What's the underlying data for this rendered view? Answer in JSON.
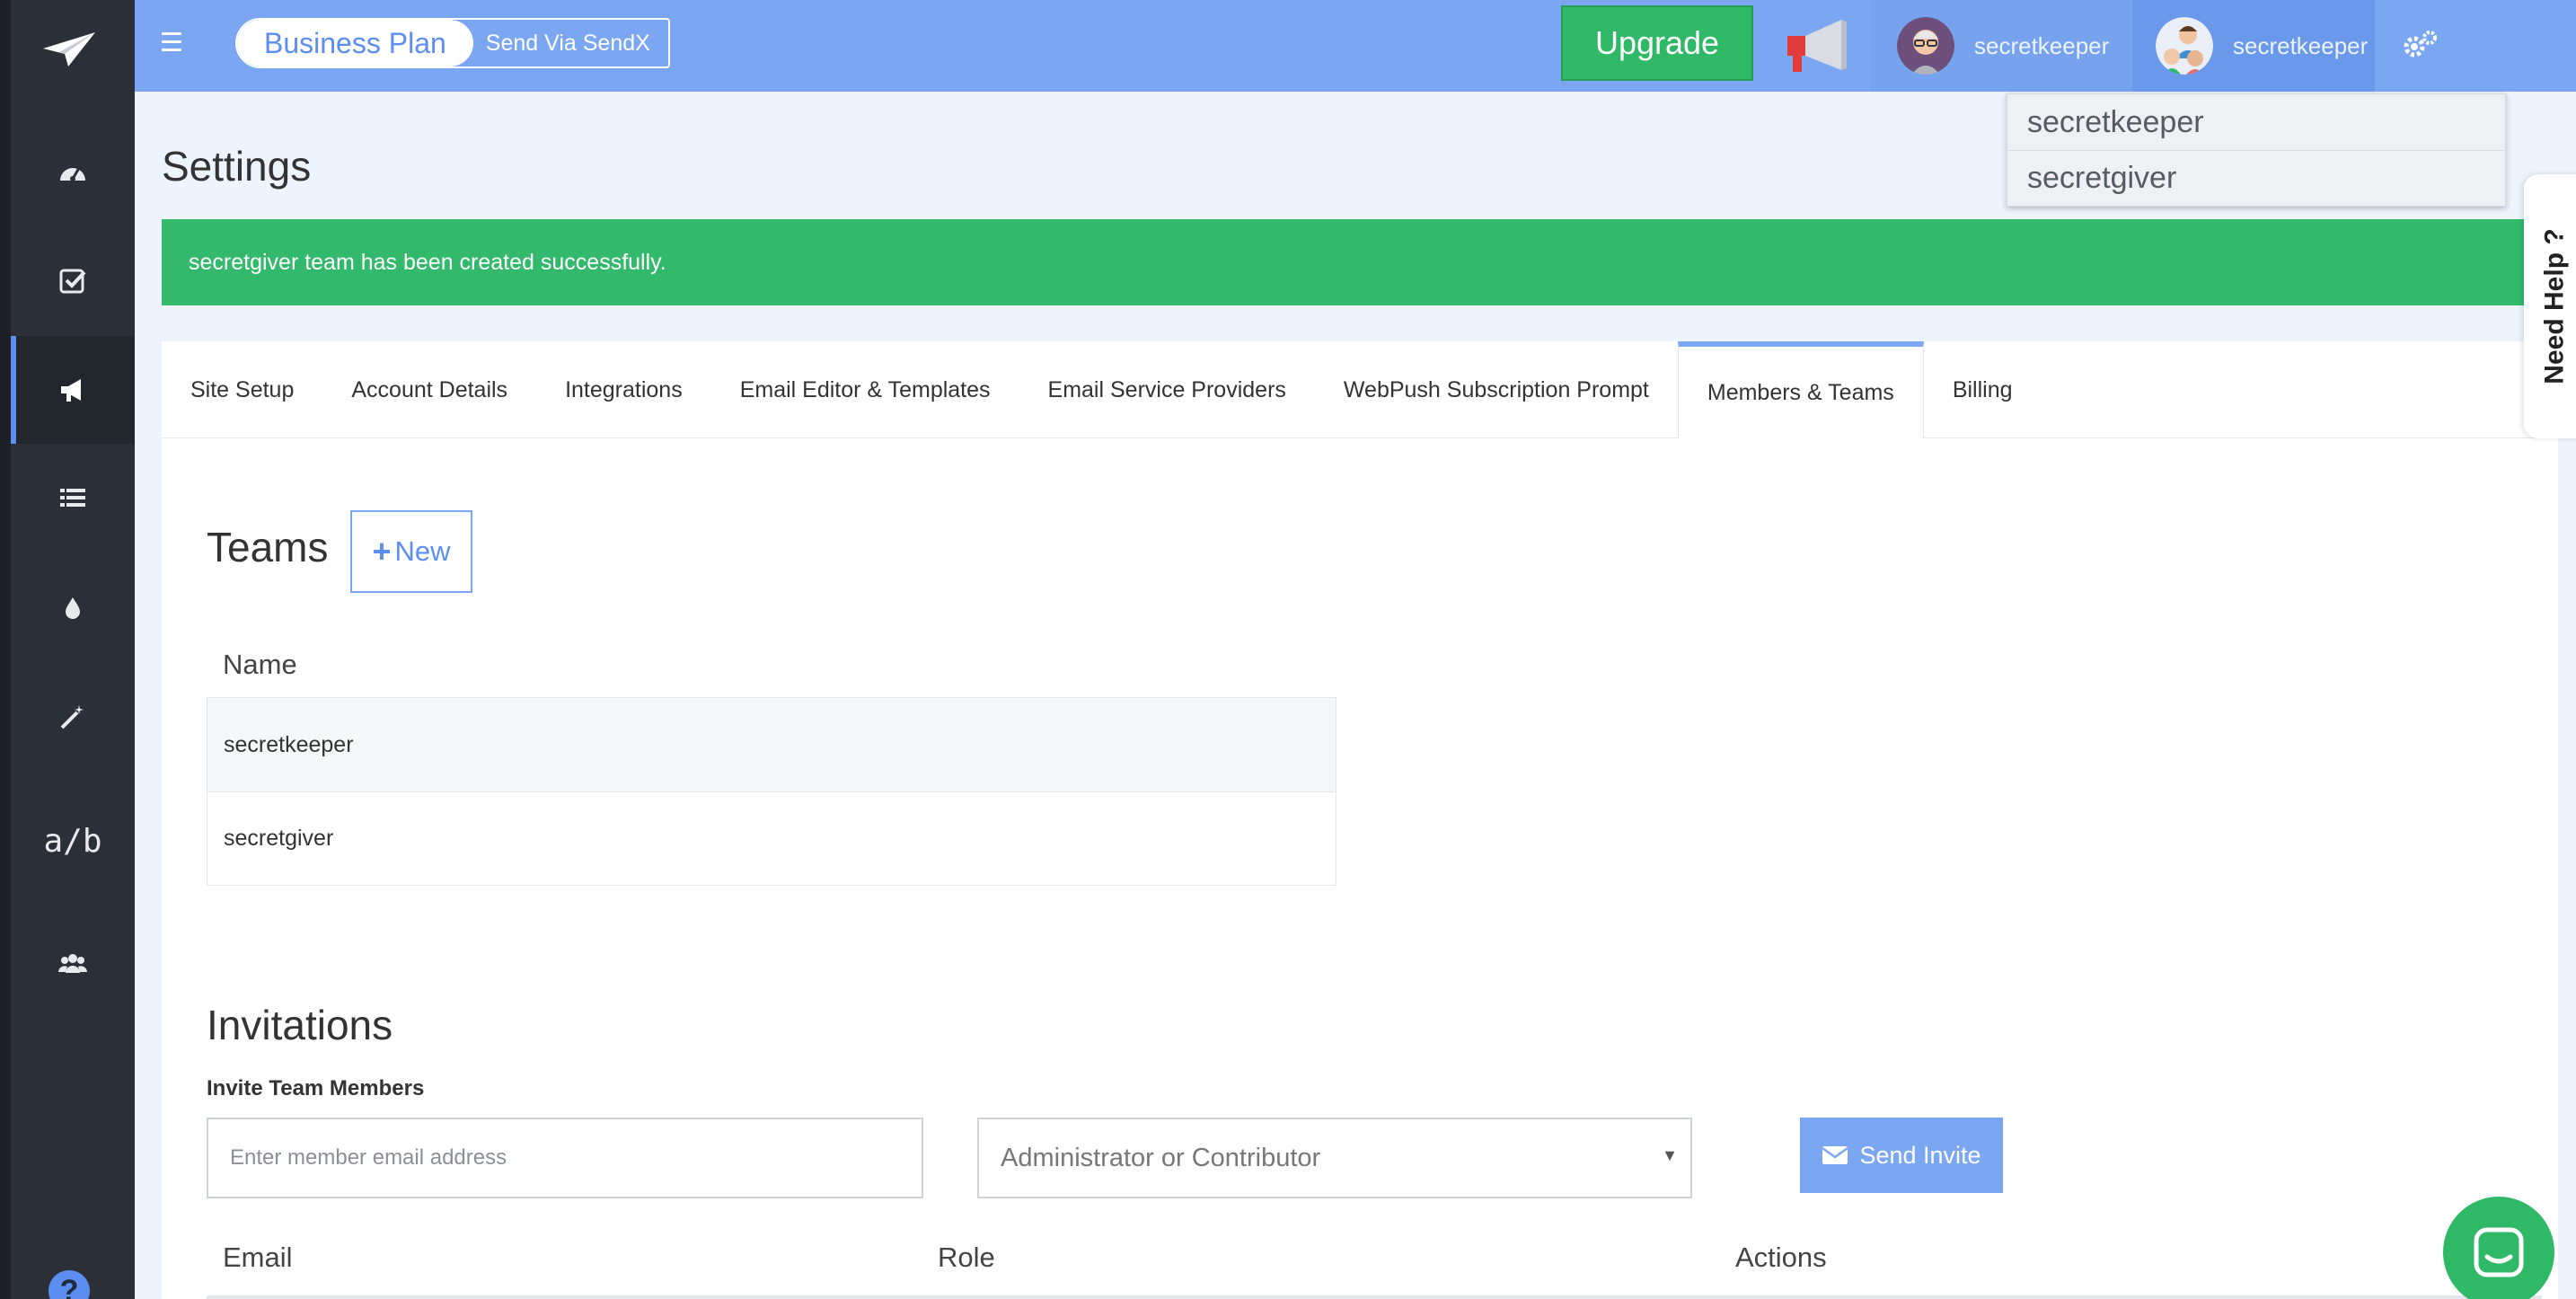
{
  "topbar": {
    "plan_label": "Business Plan",
    "send_label": "Send Via SendX",
    "upgrade_label": "Upgrade",
    "user1_name": "secretkeeper",
    "user2_name": "secretkeeper"
  },
  "dropdown": {
    "items": [
      "secretkeeper",
      "secretgiver"
    ]
  },
  "page": {
    "title": "Settings",
    "alert": "secretgiver team has been created successfully.",
    "need_help": "Need Help ?"
  },
  "sidebar": {
    "ab_label": "a/b",
    "help_glyph": "?"
  },
  "tabs": [
    {
      "label": "Site Setup"
    },
    {
      "label": "Account Details"
    },
    {
      "label": "Integrations"
    },
    {
      "label": "Email Editor & Templates"
    },
    {
      "label": "Email Service Providers"
    },
    {
      "label": "WebPush Subscription Prompt"
    },
    {
      "label": "Members & Teams"
    },
    {
      "label": "Billing"
    }
  ],
  "teams": {
    "title": "Teams",
    "new_label": "New",
    "column_name": "Name",
    "rows": [
      "secretkeeper",
      "secretgiver"
    ]
  },
  "invitations": {
    "title": "Invitations",
    "invite_label": "Invite Team Members",
    "email_placeholder": "Enter member email address",
    "role_value": "Administrator or Contributor",
    "send_label": "Send Invite",
    "columns": [
      "Email",
      "Role",
      "Actions"
    ]
  },
  "colors": {
    "topbar": "#7aa6f2",
    "sidebar": "#2b2f38",
    "success": "#33b96b",
    "accent": "#5b8ef0"
  },
  "icons": {
    "sidebar": [
      "paper-plane-icon",
      "dashboard-icon",
      "checklist-icon",
      "megaphone-icon",
      "list-icon",
      "drop-icon",
      "magic-wand-icon",
      "ab-test-icon",
      "users-icon",
      "help-icon"
    ],
    "topbar": [
      "hamburger-icon",
      "megaphone-icon",
      "avatar",
      "team-avatar",
      "gear-icon"
    ]
  }
}
